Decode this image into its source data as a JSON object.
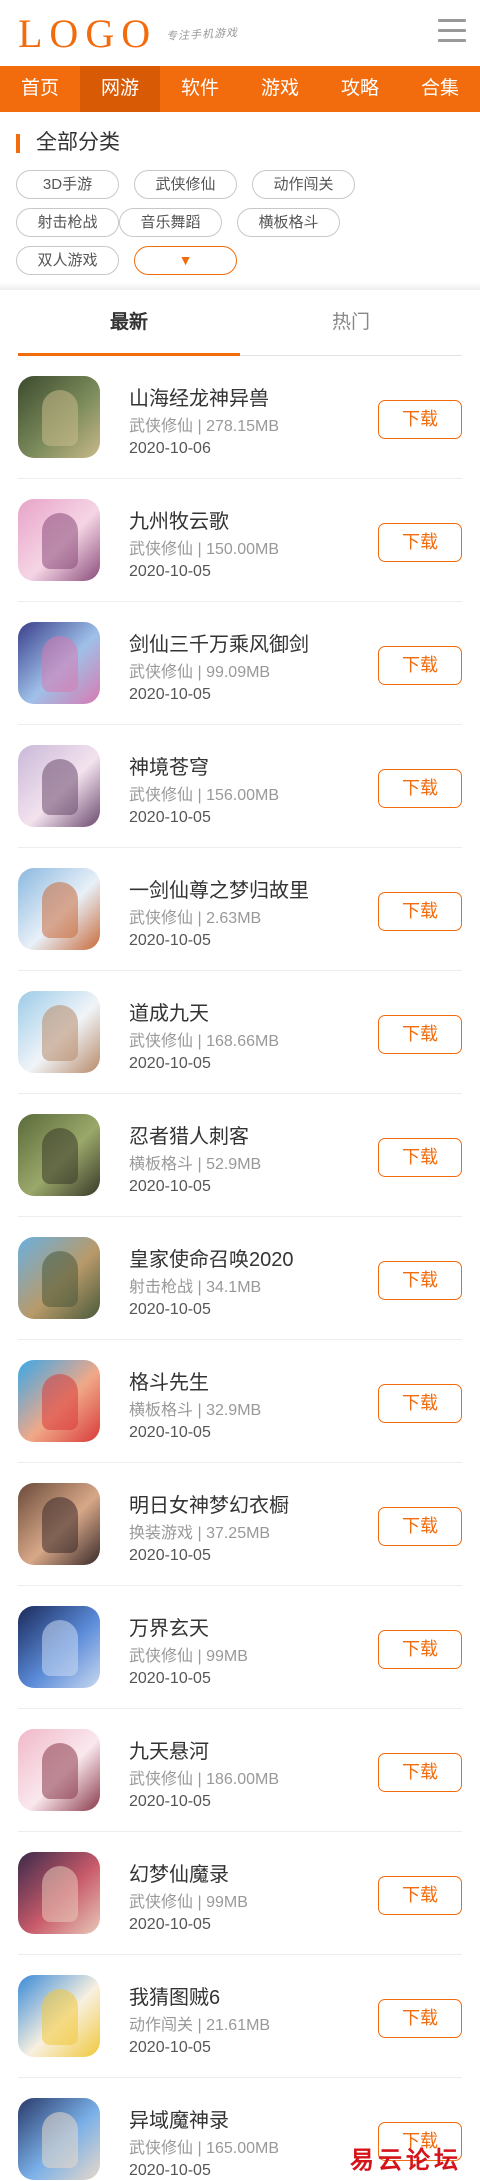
{
  "header": {
    "logo": "LOGO",
    "slogan": "专注手机游戏",
    "menu_icon": "hamburger-menu-icon"
  },
  "nav": {
    "items": [
      "首页",
      "网游",
      "软件",
      "游戏",
      "攻略",
      "合集"
    ],
    "active_index": 1
  },
  "category": {
    "title": "全部分类",
    "tags": [
      "3D手游",
      "武侠修仙",
      "动作闯关",
      "射击枪战",
      "音乐舞蹈",
      "横板格斗",
      "双人游戏"
    ],
    "more_symbol": "▼"
  },
  "tabs": {
    "items": [
      "最新",
      "热门"
    ],
    "active_index": 0
  },
  "games": [
    {
      "name": "山海经龙神异兽",
      "category": "武侠修仙",
      "size": "278.15MB",
      "date": "2020-10-06",
      "button": "下载",
      "colors": [
        "#3c4a2e",
        "#7a8a5a",
        "#c9b98a"
      ]
    },
    {
      "name": "九州牧云歌",
      "category": "武侠修仙",
      "size": "150.00MB",
      "date": "2020-10-05",
      "button": "下载",
      "colors": [
        "#e8a3c8",
        "#f5d5e5",
        "#8a4d7a"
      ]
    },
    {
      "name": "剑仙三千万乘风御剑",
      "category": "武侠修仙",
      "size": "99.09MB",
      "date": "2020-10-05",
      "button": "下载",
      "colors": [
        "#3a3f8c",
        "#9ec0e8",
        "#d87ab0"
      ]
    },
    {
      "name": "神境苍穹",
      "category": "武侠修仙",
      "size": "156.00MB",
      "date": "2020-10-05",
      "button": "下载",
      "colors": [
        "#c9b8d8",
        "#f3e3ee",
        "#6b4a6e"
      ]
    },
    {
      "name": "一剑仙尊之梦归故里",
      "category": "武侠修仙",
      "size": "2.63MB",
      "date": "2020-10-05",
      "button": "下载",
      "colors": [
        "#8ab8e0",
        "#e8f0f8",
        "#c86a3a"
      ]
    },
    {
      "name": "道成九天",
      "category": "武侠修仙",
      "size": "168.66MB",
      "date": "2020-10-05",
      "button": "下载",
      "colors": [
        "#9ccbe8",
        "#f0f4f8",
        "#b88a6a"
      ]
    },
    {
      "name": "忍者猎人刺客",
      "category": "横板格斗",
      "size": "52.9MB",
      "date": "2020-10-05",
      "button": "下载",
      "colors": [
        "#5a6a3a",
        "#9aa86a",
        "#3a3a2a"
      ]
    },
    {
      "name": "皇家使命召唤2020",
      "category": "射击枪战",
      "size": "34.1MB",
      "date": "2020-10-05",
      "button": "下载",
      "colors": [
        "#6ab0e0",
        "#b89a6a",
        "#4a5a3a"
      ]
    },
    {
      "name": "格斗先生",
      "category": "横板格斗",
      "size": "32.9MB",
      "date": "2020-10-05",
      "button": "下载",
      "colors": [
        "#3aa8e8",
        "#f0a888",
        "#d83a3a"
      ]
    },
    {
      "name": "明日女神梦幻衣橱",
      "category": "换装游戏",
      "size": "37.25MB",
      "date": "2020-10-05",
      "button": "下载",
      "colors": [
        "#6a4a3a",
        "#d8a888",
        "#3a2a2a"
      ]
    },
    {
      "name": "万界玄天",
      "category": "武侠修仙",
      "size": "99MB",
      "date": "2020-10-05",
      "button": "下载",
      "colors": [
        "#1a2a5a",
        "#5a8ad8",
        "#c8d8f0"
      ]
    },
    {
      "name": "九天悬河",
      "category": "武侠修仙",
      "size": "186.00MB",
      "date": "2020-10-05",
      "button": "下载",
      "colors": [
        "#f0b8c8",
        "#fae8ee",
        "#8a3a4a"
      ]
    },
    {
      "name": "幻梦仙魔录",
      "category": "武侠修仙",
      "size": "99MB",
      "date": "2020-10-05",
      "button": "下载",
      "colors": [
        "#3a2a4a",
        "#c85a6a",
        "#e8c8b8"
      ]
    },
    {
      "name": "我猜图贼6",
      "category": "动作闯关",
      "size": "21.61MB",
      "date": "2020-10-05",
      "button": "下载",
      "colors": [
        "#3a8ad8",
        "#f8f0e0",
        "#f0c83a"
      ]
    },
    {
      "name": "异域魔神录",
      "category": "武侠修仙",
      "size": "165.00MB",
      "date": "2020-10-05",
      "button": "下载",
      "colors": [
        "#2a3a6a",
        "#7ab0e8",
        "#e8d8c8"
      ]
    }
  ],
  "watermark": "易云论坛",
  "separator": "|"
}
